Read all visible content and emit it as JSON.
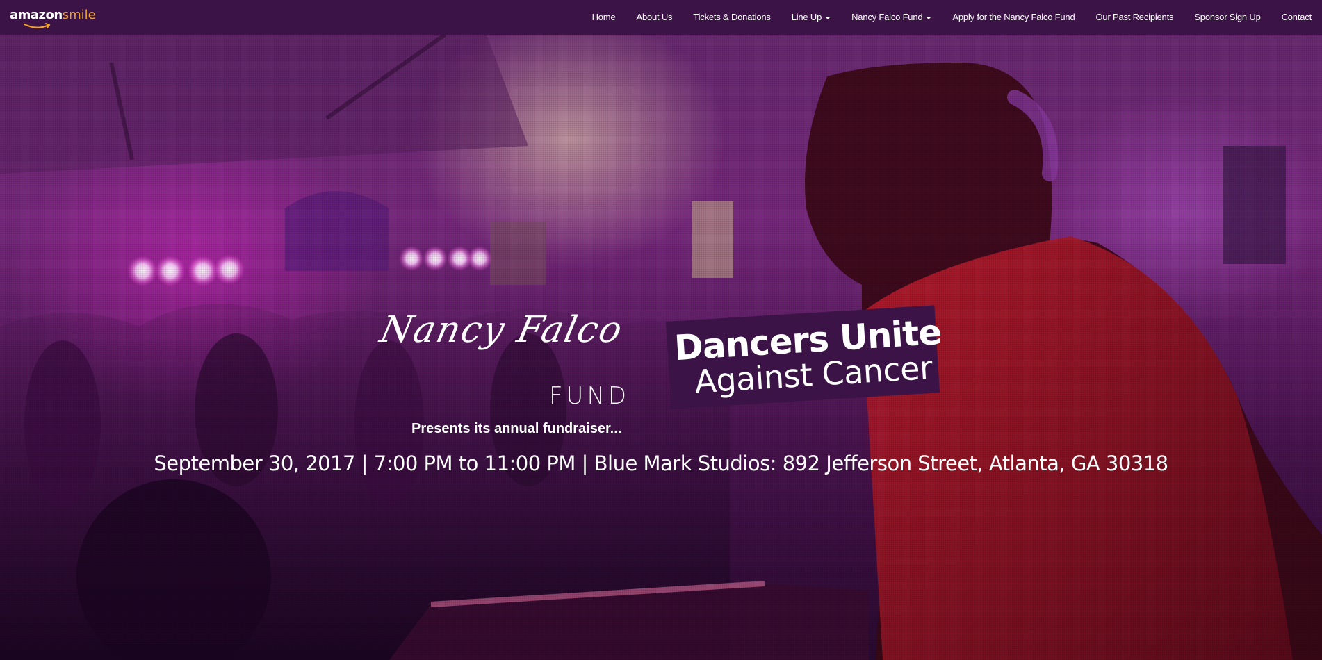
{
  "navbar": {
    "logo": {
      "amazon": "amazon",
      "smile": "smile"
    },
    "items": [
      {
        "label": "Home",
        "dropdown": false
      },
      {
        "label": "About Us",
        "dropdown": false
      },
      {
        "label": "Tickets & Donations",
        "dropdown": false
      },
      {
        "label": "Line Up",
        "dropdown": true
      },
      {
        "label": "Nancy Falco Fund",
        "dropdown": true
      },
      {
        "label": "Apply for the Nancy Falco Fund",
        "dropdown": false
      },
      {
        "label": "Our Past Recipients",
        "dropdown": false
      },
      {
        "label": "Sponsor Sign Up",
        "dropdown": false
      },
      {
        "label": "Contact",
        "dropdown": false
      }
    ]
  },
  "hero": {
    "fund_logo": {
      "script": "Nancy Falco",
      "word": "FUND"
    },
    "event_logo": {
      "line1": "Dancers Unite",
      "line2": "Against Cancer"
    },
    "presents": "Presents its annual fundraiser...",
    "event_info": "September 30, 2017 | 7:00 PM to 11:00 PM | Blue Mark Studios: 892 Jefferson Street, Atlanta, GA 30318"
  },
  "colors": {
    "navbar_bg": "#3b1346",
    "accent_smile": "#f0a22e",
    "text": "#ffffff"
  }
}
